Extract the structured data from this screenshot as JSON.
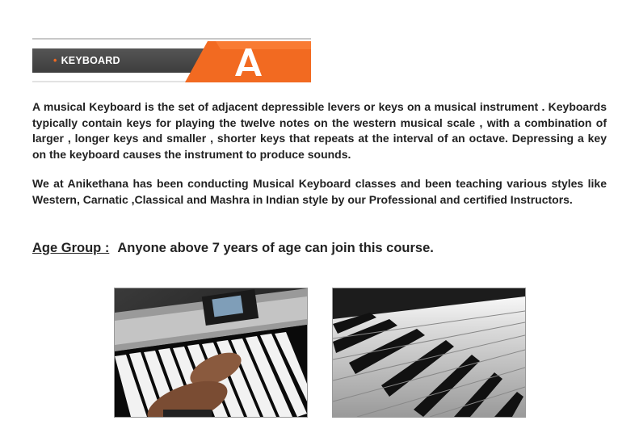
{
  "header": {
    "title": "KEYBOARD",
    "bullet": "•",
    "logo_icon": "anikethana-a-logo-icon",
    "accent_color": "#f26a21"
  },
  "content": {
    "paragraph1": "A musical Keyboard is the set of adjacent depressible levers or keys on a musical instrument . Keyboards typically contain keys for playing the twelve notes on the western musical scale , with a combination of larger , longer keys and smaller , shorter keys that repeats at the interval of an octave. Depressing a key on the keyboard causes the instrument to produce sounds.",
    "paragraph2": "We at Anikethana has been conducting Musical Keyboard classes and been teaching various styles like Western, Carnatic ,Classical and Mashra in Indian style by our Professional and certified Instructors.",
    "age_label": "Age Group :",
    "age_text": "Anyone above 7 years of age can join this course."
  },
  "images": [
    {
      "name": "hands-on-keyboard-photo"
    },
    {
      "name": "piano-keys-closeup-photo"
    }
  ]
}
